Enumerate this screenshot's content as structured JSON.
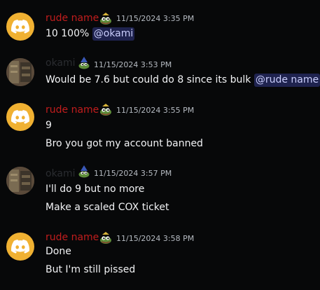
{
  "colors": {
    "background": "#070809",
    "username_red": "#c21d1d",
    "username_hidden": "#2a2c30",
    "text": "#f2f3f5",
    "timestamp": "#b5bac1",
    "mention_bg": "#2f3352",
    "mention_text": "#c9cdfb",
    "discord_avatar_bg": "#f0b132"
  },
  "messages": [
    {
      "author": "rude name",
      "author_icon": "discord-logo-icon",
      "badge": "pepe-badge-icon",
      "timestamp": "11/15/2024 3:35 PM",
      "lines": [
        {
          "text": "10 100% ",
          "mention": "@okami"
        }
      ]
    },
    {
      "author": "okami",
      "author_icon": "photo-avatar",
      "badge": "pepe-wizard-badge-icon",
      "timestamp": "11/15/2024 3:53 PM",
      "lines": [
        {
          "text": "Would be 7.6 but could do 8 since its bulk ",
          "mention": "@rude name"
        }
      ]
    },
    {
      "author": "rude name",
      "author_icon": "discord-logo-icon",
      "badge": "pepe-badge-icon",
      "timestamp": "11/15/2024 3:55 PM",
      "lines": [
        {
          "text": "9"
        },
        {
          "text": "Bro you got my account banned"
        }
      ]
    },
    {
      "author": "okami",
      "author_icon": "photo-avatar",
      "badge": "pepe-wizard-badge-icon",
      "timestamp": "11/15/2024 3:57 PM",
      "lines": [
        {
          "text": "I'll do 9 but no more"
        },
        {
          "text": "Make a scaled COX ticket"
        }
      ]
    },
    {
      "author": "rude name",
      "author_icon": "discord-logo-icon",
      "badge": "pepe-badge-icon",
      "timestamp": "11/15/2024 3:58 PM",
      "lines": [
        {
          "text": "Done"
        },
        {
          "text": "But I'm still pissed"
        }
      ]
    }
  ]
}
